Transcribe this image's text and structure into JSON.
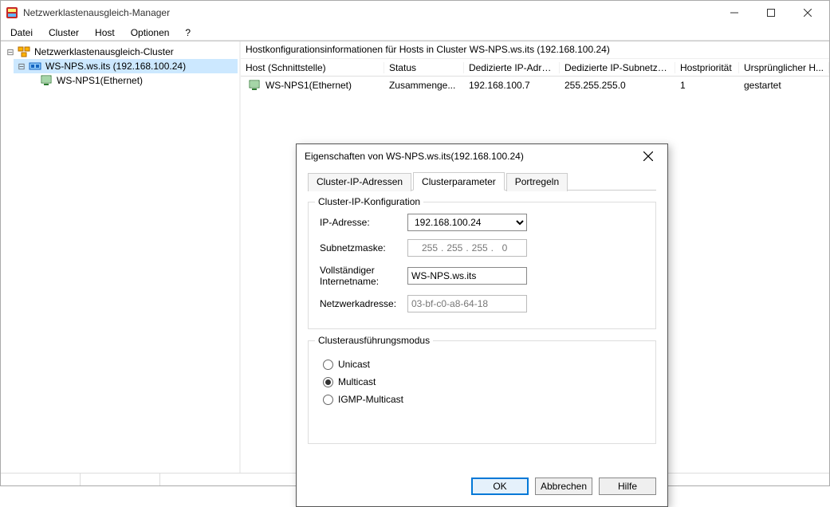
{
  "window": {
    "title": "Netzwerklastenausgleich-Manager"
  },
  "menu": {
    "file": "Datei",
    "cluster": "Cluster",
    "host": "Host",
    "options": "Optionen",
    "help": "?"
  },
  "tree": {
    "root": "Netzwerklastenausgleich-Cluster",
    "node1": "WS-NPS.ws.its (192.168.100.24)",
    "node2": "WS-NPS1(Ethernet)"
  },
  "infoHeader": "Hostkonfigurationsinformationen für Hosts in Cluster WS-NPS.ws.its (192.168.100.24)",
  "table": {
    "cols": {
      "c0": "Host (Schnittstelle)",
      "c1": "Status",
      "c2": "Dedizierte IP-Adresse",
      "c3": "Dedizierte IP-Subnetzma...",
      "c4": "Hostpriorität",
      "c5": "Ursprünglicher H..."
    },
    "row": {
      "c0": "WS-NPS1(Ethernet)",
      "c1": "Zusammenge...",
      "c2": "192.168.100.7",
      "c3": "255.255.255.0",
      "c4": "1",
      "c5": "gestartet"
    }
  },
  "dialog": {
    "title": "Eigenschaften von WS-NPS.ws.its(192.168.100.24)",
    "tabs": {
      "t1": "Cluster-IP-Adressen",
      "t2": "Clusterparameter",
      "t3": "Portregeln"
    },
    "group1": {
      "legend": "Cluster-IP-Konfiguration",
      "ipLabel": "IP-Adresse:",
      "ipValue": "192.168.100.24",
      "subnetLabel": "Subnetzmaske:",
      "subnet": {
        "a": "255",
        "b": "255",
        "c": "255",
        "d": "0"
      },
      "fqdnLabel": "Vollständiger Internetname:",
      "fqdnValue": "WS-NPS.ws.its",
      "macLabel": "Netzwerkadresse:",
      "macValue": "03-bf-c0-a8-64-18"
    },
    "group2": {
      "legend": "Clusterausführungsmodus",
      "r1": "Unicast",
      "r2": "Multicast",
      "r3": "IGMP-Multicast"
    },
    "buttons": {
      "ok": "OK",
      "cancel": "Abbrechen",
      "help": "Hilfe"
    }
  }
}
